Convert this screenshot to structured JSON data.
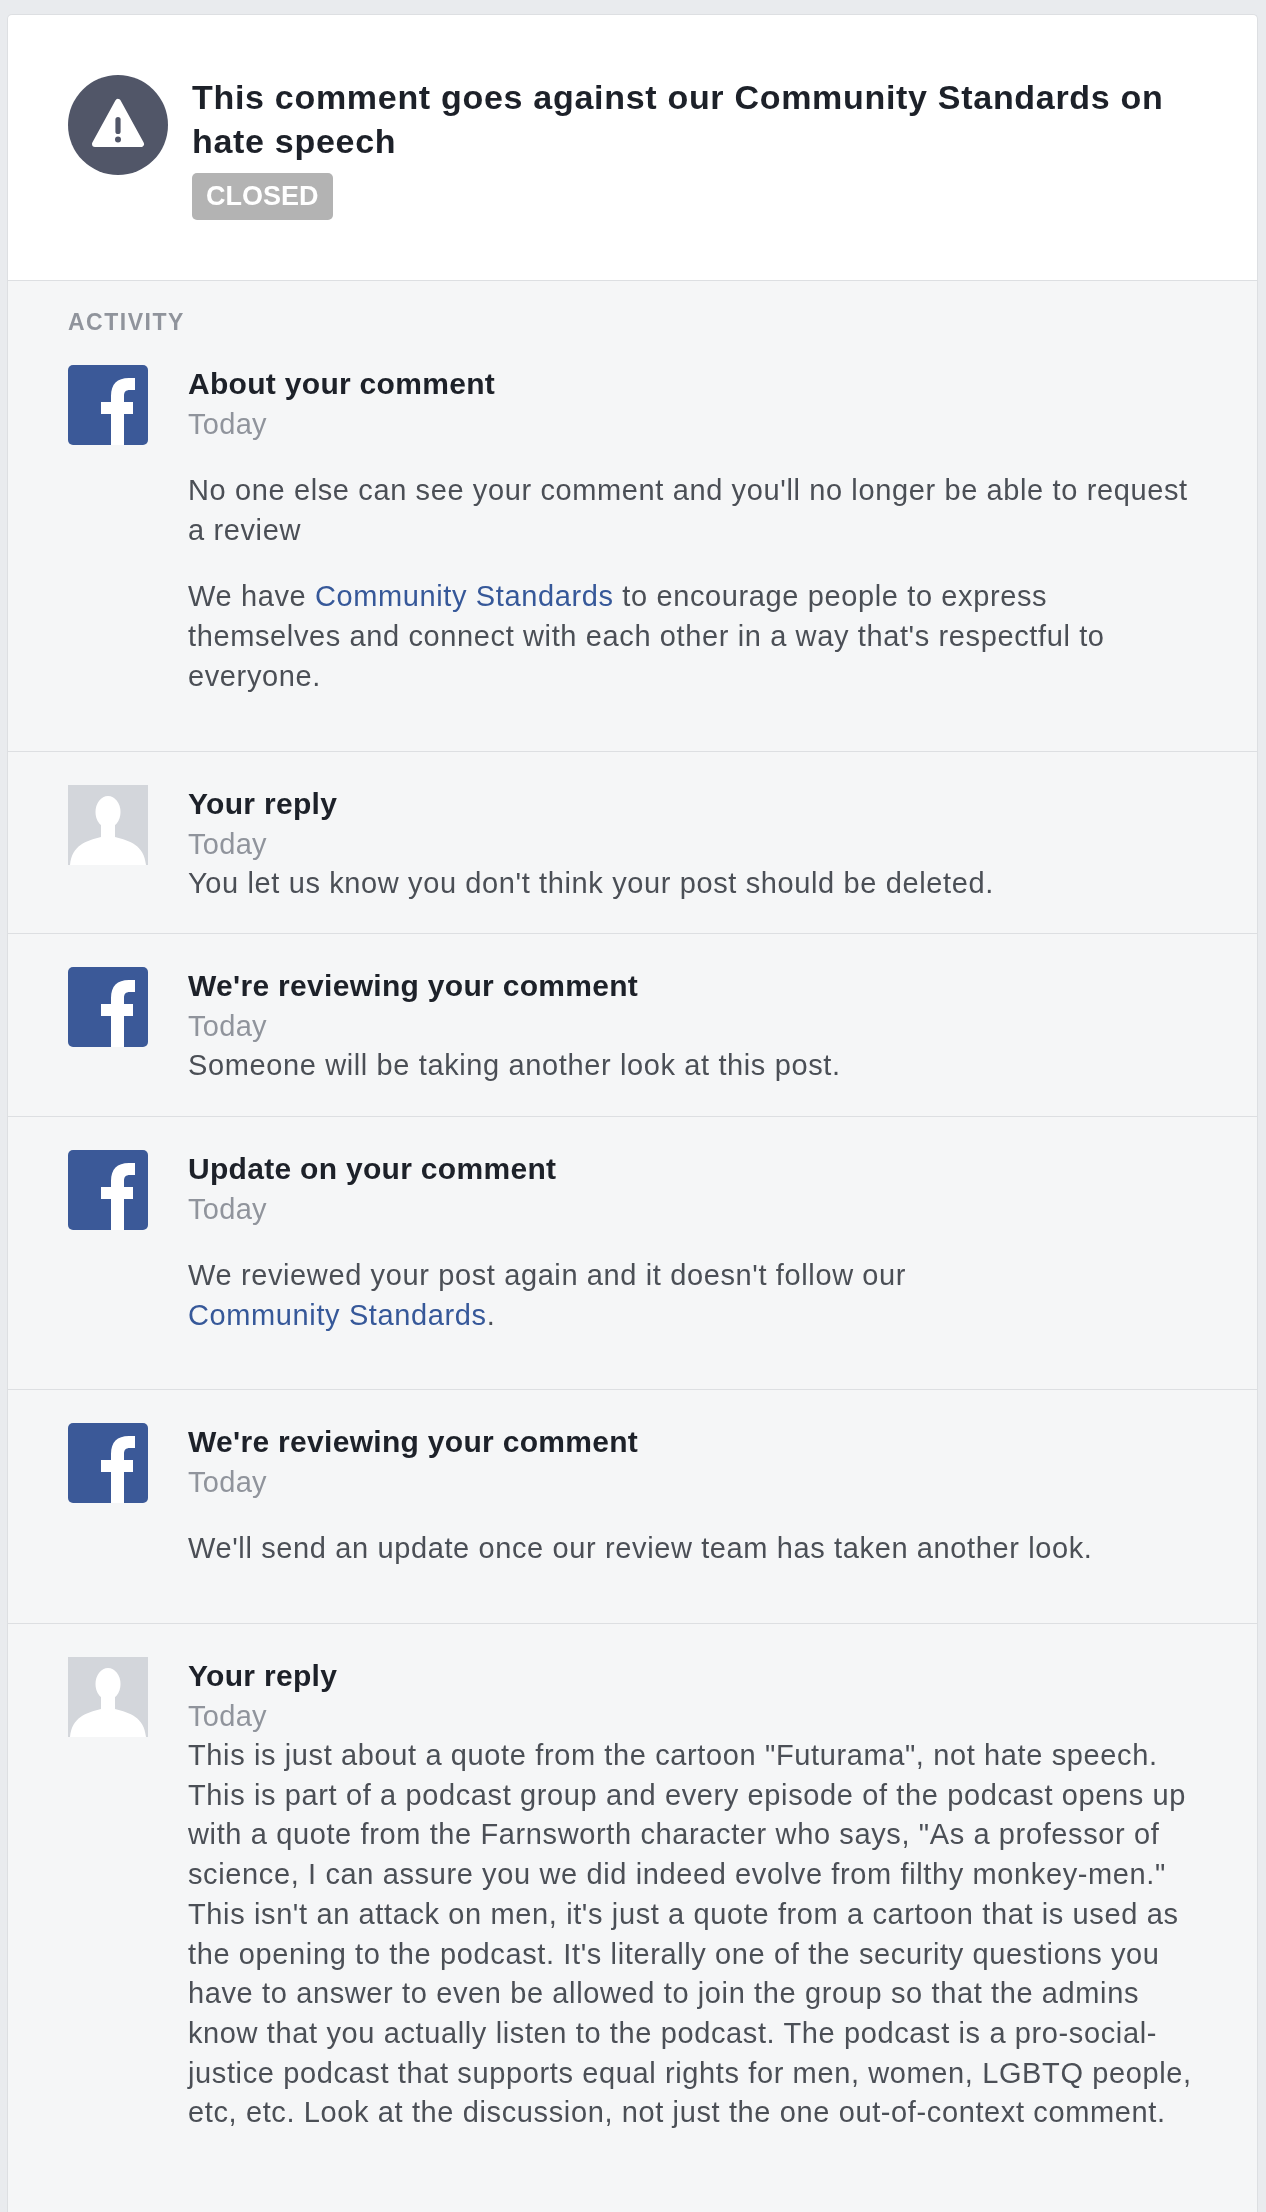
{
  "notice": {
    "title": "This comment goes against our Community Standards on hate speech",
    "status": "CLOSED"
  },
  "activity": {
    "heading": "ACTIVITY",
    "items": [
      {
        "kind": "spaced",
        "avatar": {
          "kind": "logo"
        },
        "title": "About your comment",
        "time": "Today",
        "paragraphs": [
          [
            {
              "kind": "text",
              "text": "No one else can see your comment and you'll no longer be able to request a review"
            }
          ],
          [
            {
              "kind": "text",
              "text": "We have "
            },
            {
              "kind": "link",
              "text": "Community Standards"
            },
            {
              "kind": "text",
              "text": " to encourage people to express themselves and connect with each other in a way that's respectful to everyone."
            }
          ]
        ]
      },
      {
        "kind": "compact",
        "avatar": {
          "kind": "person"
        },
        "title": "Your reply",
        "time": "Today",
        "paragraphs": [
          [
            {
              "kind": "text",
              "text": "You let us know you don't think your post should be deleted."
            }
          ]
        ]
      },
      {
        "kind": "compact",
        "avatar": {
          "kind": "logo"
        },
        "title": "We're reviewing your comment",
        "time": "Today",
        "paragraphs": [
          [
            {
              "kind": "text",
              "text": "Someone will be taking another look at this post."
            }
          ]
        ]
      },
      {
        "kind": "spaced",
        "avatar": {
          "kind": "logo"
        },
        "title": "Update on your comment",
        "time": "Today",
        "paragraphs": [
          [
            {
              "kind": "text",
              "text": "We reviewed your post again and it doesn't follow our "
            },
            {
              "kind": "link",
              "text": "Community Standards"
            },
            {
              "kind": "text",
              "text": "."
            }
          ]
        ]
      },
      {
        "kind": "spaced",
        "avatar": {
          "kind": "logo"
        },
        "title": "We're reviewing your comment",
        "time": "Today",
        "paragraphs": [
          [
            {
              "kind": "text",
              "text": "We'll send an update once our review team has taken another look."
            }
          ]
        ]
      },
      {
        "kind": "compact",
        "avatar": {
          "kind": "person"
        },
        "title": "Your reply",
        "time": "Today",
        "paragraphs": [
          [
            {
              "kind": "text",
              "text": "This is just about a quote from the cartoon \"Futurama\", not hate speech. This is part of a podcast group and every episode of the podcast opens up with a quote from the Farnsworth character who says, \"As a professor of science, I can assure you we did indeed evolve from filthy monkey-men.\" This isn't an attack on men, it's just a quote from a cartoon that is used as the opening to the podcast. It's literally one of the security questions you have to answer to even be allowed to join the group so that the admins know that you actually listen to the podcast. The podcast is a pro-social-justice podcast that supports equal rights for men, women, LGBTQ people, etc, etc. Look at the discussion, not just the one out-of-context comment."
            }
          ]
        ]
      }
    ]
  }
}
